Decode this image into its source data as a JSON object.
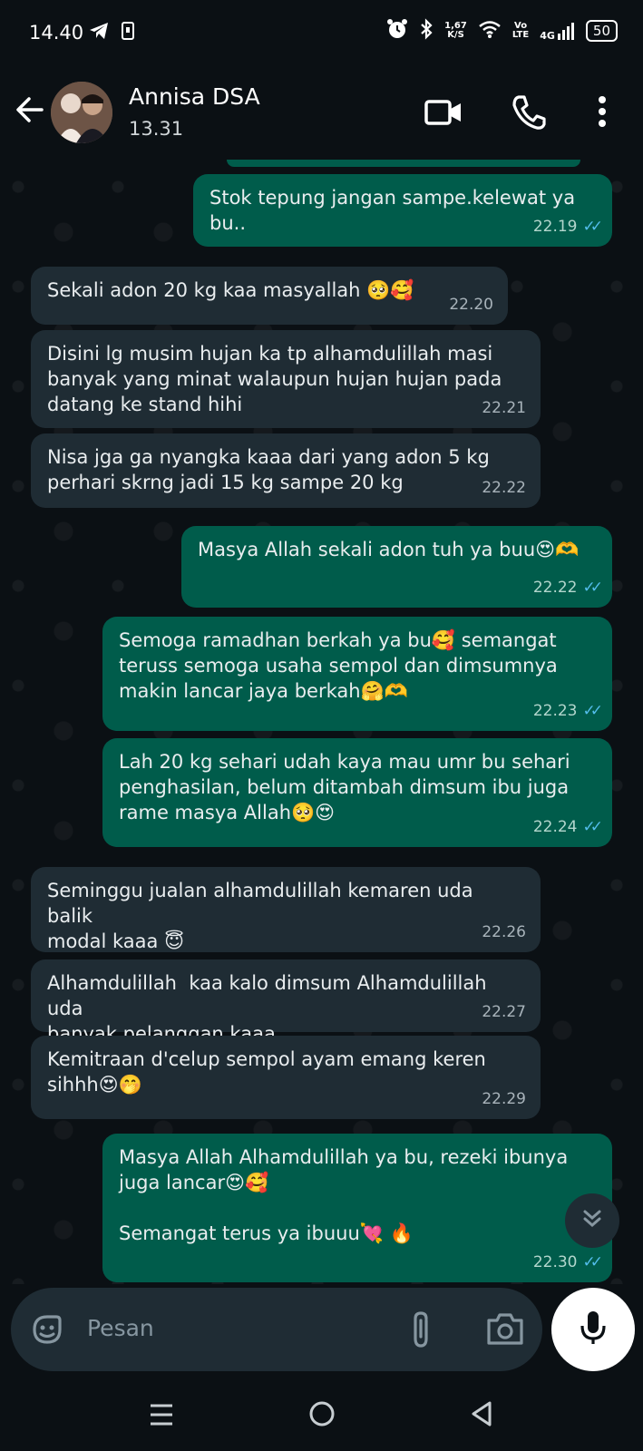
{
  "status_bar": {
    "time": "14.40",
    "speed_top": "1,67",
    "speed_bottom": "K/S",
    "volte_top": "Vo",
    "volte_bottom": "LTE",
    "network": "4G",
    "battery": "50"
  },
  "header": {
    "contact_name": "Annisa DSA",
    "subtitle": "13.31"
  },
  "messages": [
    {
      "dir": "out",
      "text": "Stok tepung jangan sampe.kelewat ya bu..",
      "time": "22.19",
      "ticks": "✓✓"
    },
    {
      "dir": "in",
      "text": "Sekali adon 20 kg kaa masyallah 🥺🥰",
      "time": "22.20"
    },
    {
      "dir": "in",
      "text": "Disini lg musim hujan ka tp alhamdulillah masi\nbanyak yang minat walaupun hujan hujan pada\ndatang ke stand hihi",
      "time": "22.21"
    },
    {
      "dir": "in",
      "text": "Nisa jga ga nyangka kaaa dari yang adon 5 kg\nperhari skrng jadi 15 kg sampe 20 kg",
      "time": "22.22"
    },
    {
      "dir": "out",
      "text": "Masya Allah sekali adon tuh ya buu😍🫶",
      "time": "22.22",
      "ticks": "✓✓"
    },
    {
      "dir": "out",
      "text": "Semoga ramadhan berkah ya bu🥰 semangat\nteruss semoga usaha sempol dan dimsumnya\nmakin lancar jaya berkah🤗🫶",
      "time": "22.23",
      "ticks": "✓✓"
    },
    {
      "dir": "out",
      "text": "Lah 20 kg sehari udah kaya mau umr bu sehari\npenghasilan, belum ditambah dimsum ibu juga\nrame masya Allah🥺😍",
      "time": "22.24",
      "ticks": "✓✓"
    },
    {
      "dir": "in",
      "text": "Seminggu jualan alhamdulillah kemaren uda balik\nmodal kaaa 😇",
      "time": "22.26"
    },
    {
      "dir": "in",
      "text": "Alhamdulillah  kaa kalo dimsum Alhamdulillah uda\nbanyak pelanggan kaaa",
      "time": "22.27"
    },
    {
      "dir": "in",
      "text": "Kemitraan d'celup sempol ayam emang keren\nsihhh😍🤭",
      "time": "22.29"
    },
    {
      "dir": "out",
      "text": "Masya Allah Alhamdulillah ya bu, rezeki ibunya\njuga lancar😍🥰\n\nSemangat terus ya ibuuu💘 🔥",
      "time": "22.30",
      "ticks": "✓✓"
    }
  ],
  "composer": {
    "placeholder": "Pesan"
  },
  "icons": {
    "back": "arrow-left-icon",
    "video": "video-call-icon",
    "call": "phone-icon",
    "menu": "more-vert-icon",
    "sticker": "sticker-icon",
    "attach": "paperclip-icon",
    "camera": "camera-icon",
    "mic": "mic-icon",
    "scroll": "chevron-double-down-icon"
  },
  "colors": {
    "incoming_bubble": "#1f2c34",
    "outgoing_bubble": "#005c4b",
    "read_ticks": "#53bdeb",
    "background": "#0b1014"
  }
}
